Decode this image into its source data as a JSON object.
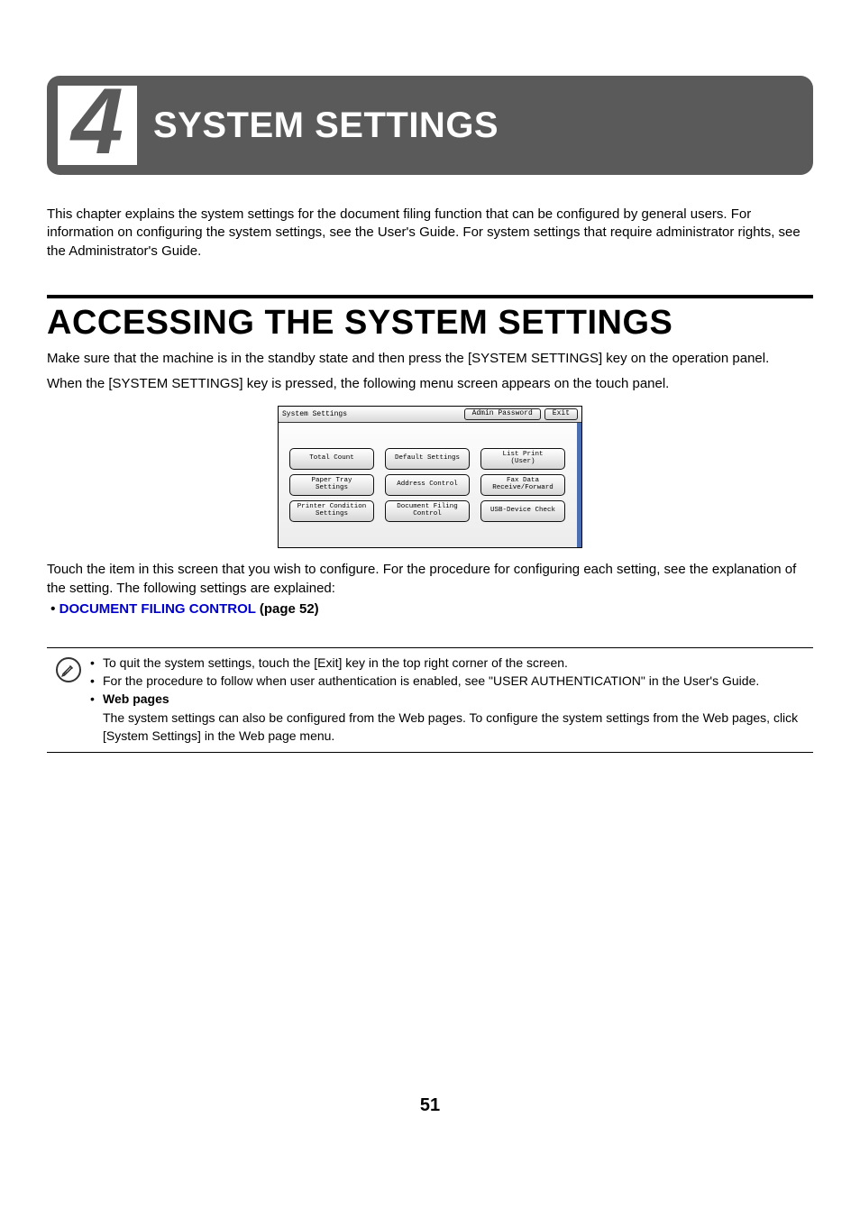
{
  "chapter": {
    "number": "4",
    "title": "SYSTEM SETTINGS"
  },
  "intro": "This chapter explains the system settings for the document filing function that can be configured by general users. For information on configuring the system settings, see the User's Guide. For system settings that require administrator rights, see the Administrator's Guide.",
  "section_title": "ACCESSING THE SYSTEM SETTINGS",
  "para1": "Make sure that the machine is in the standby state and then press the [SYSTEM SETTINGS] key on the operation panel.",
  "para2": "When the [SYSTEM SETTINGS] key is pressed, the following menu screen appears on the touch panel.",
  "panel": {
    "header_title": "System Settings",
    "admin_btn": "Admin Password",
    "exit_btn": "Exit",
    "buttons": [
      [
        "Total Count",
        "Default Settings",
        "List Print\n(User)"
      ],
      [
        "Paper Tray\nSettings",
        "Address Control",
        "Fax Data\nReceive/Forward"
      ],
      [
        "Printer Condition\nSettings",
        "Document Filing\nControl",
        "USB-Device Check"
      ]
    ]
  },
  "para3": "Touch the item in this screen that you wish to configure. For the procedure for configuring each setting, see the explanation of the setting. The following settings are explained:",
  "link_line": {
    "bullet": "•",
    "link_text": "DOCUMENT FILING CONTROL",
    "suffix": " (page 52)"
  },
  "note": {
    "items": [
      "To quit the system settings, touch the [Exit] key in the top right corner of the screen.",
      "For the procedure to follow when user authentication is enabled, see \"USER AUTHENTICATION\" in the User's Guide."
    ],
    "web_label": "Web pages",
    "web_text": "The system settings can also be configured from the Web pages. To configure the system settings from the Web pages, click [System Settings] in the Web page menu."
  },
  "page_number": "51"
}
